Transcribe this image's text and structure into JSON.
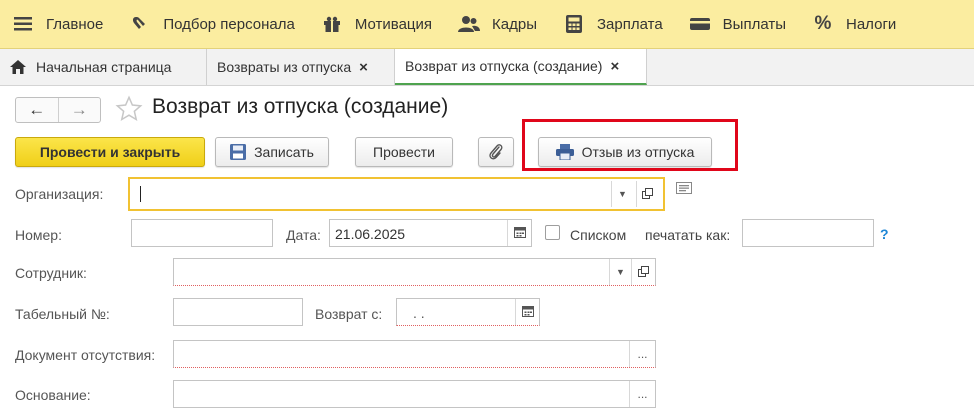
{
  "sections": [
    {
      "label": "Главное",
      "icon": "menu-icon"
    },
    {
      "label": "Подбор персонала",
      "icon": "handshake-icon"
    },
    {
      "label": "Мотивация",
      "icon": "gift-icon"
    },
    {
      "label": "Кадры",
      "icon": "users-icon"
    },
    {
      "label": "Зарплата",
      "icon": "calculator-icon"
    },
    {
      "label": "Выплаты",
      "icon": "wallet-icon"
    },
    {
      "label": "Налоги",
      "icon": "percent-icon"
    }
  ],
  "tabs": [
    {
      "label": "Начальная страница"
    },
    {
      "label": "Возвраты из отпуска",
      "close": "×"
    },
    {
      "label": "Возврат из отпуска (создание)",
      "close": "×"
    }
  ],
  "nav": {
    "back": "←",
    "forward": "→"
  },
  "form_title": "Возврат из отпуска (создание)",
  "toolbar": {
    "post_close": "Провести и закрыть",
    "save": "Записать",
    "post": "Провести",
    "recall": "Отзыв из отпуска"
  },
  "form": {
    "organization_label": "Организация:",
    "organization_value": "",
    "number_label": "Номер:",
    "number_value": "",
    "date_label": "Дата:",
    "date_value": "21.06.2025",
    "list_label": "Списком",
    "print_as_label": "печатать как:",
    "print_as_value": "",
    "help": "?",
    "employee_label": "Сотрудник:",
    "employee_value": "",
    "tab_number_label": "Табельный №:",
    "tab_number_value": "",
    "return_from_label": "Возврат с:",
    "return_from_value": ". .",
    "absence_doc_label": "Документ отсутствия:",
    "absence_doc_value": "",
    "basis_label": "Основание:",
    "basis_value": "",
    "ellipsis": "..."
  },
  "colors": {
    "section_bar": "#fbeda0",
    "primary_button": "#f0cf18",
    "highlight_frame": "#e0061a",
    "active_tab_underline": "#4fa34f",
    "org_field_border": "#f1c232",
    "help_link": "#1d86d6"
  }
}
